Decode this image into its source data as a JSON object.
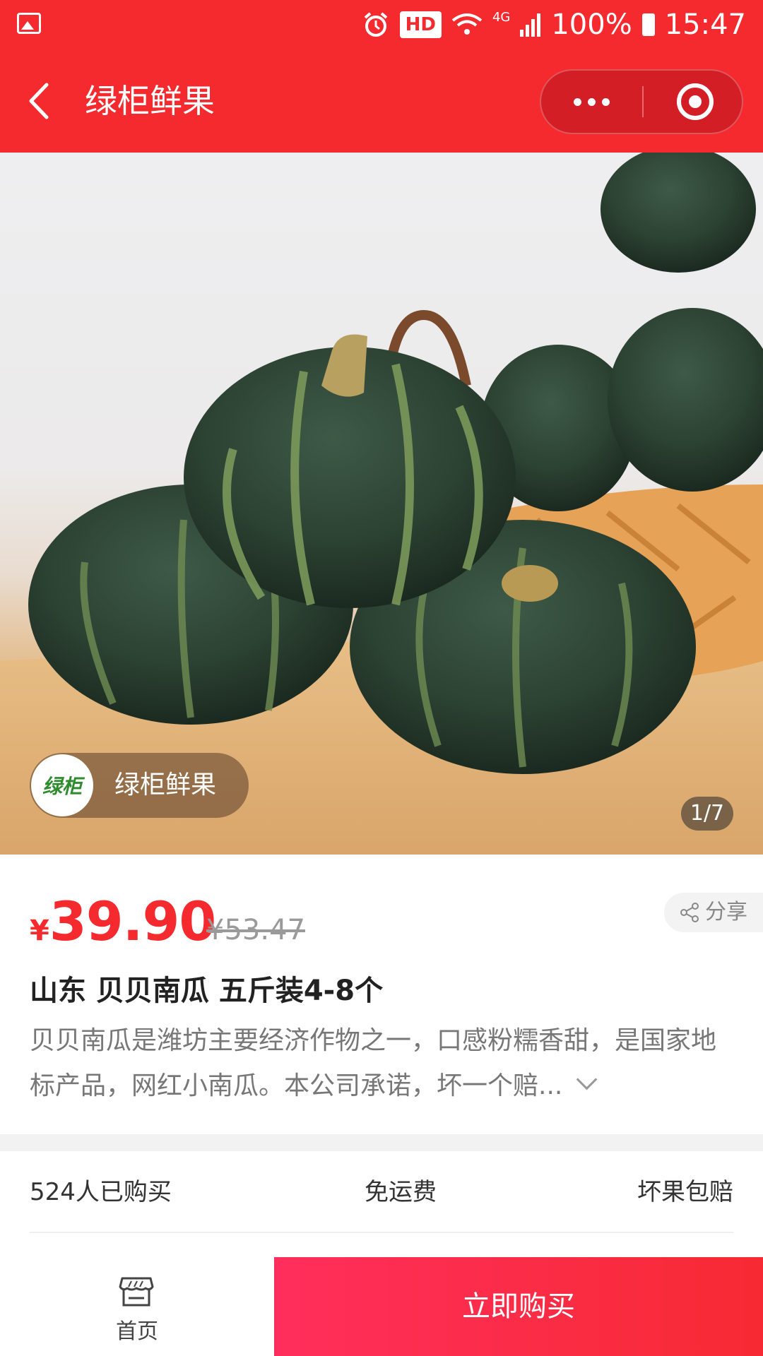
{
  "status_bar": {
    "hd": "HD",
    "network": "4G",
    "battery": "100%",
    "time": "15:47"
  },
  "nav": {
    "title": "绿柜鲜果"
  },
  "hero": {
    "shop_logo_text": "绿柜",
    "shop_name": "绿柜鲜果",
    "pager": "1/7"
  },
  "product": {
    "currency": "¥",
    "price": "39.90",
    "original_price": "¥53.47",
    "share_label": "分享",
    "title": "山东 贝贝南瓜 五斤装4-8个",
    "description": "贝贝南瓜是潍坊主要经济作物之一，口感粉糯香甜，是国家地标产品，网红小南瓜。本公司承诺，坏一个赔..."
  },
  "features": {
    "sold": "524人已购买",
    "shipping": "免运费",
    "guarantee": "坏果包赔"
  },
  "bottom": {
    "home_label": "首页",
    "buy_label": "立即购买"
  },
  "colors": {
    "brand_red": "#f42a2f",
    "buy_gradient_start": "#ff2e5c",
    "pumpkin_green": "#2c4233"
  }
}
